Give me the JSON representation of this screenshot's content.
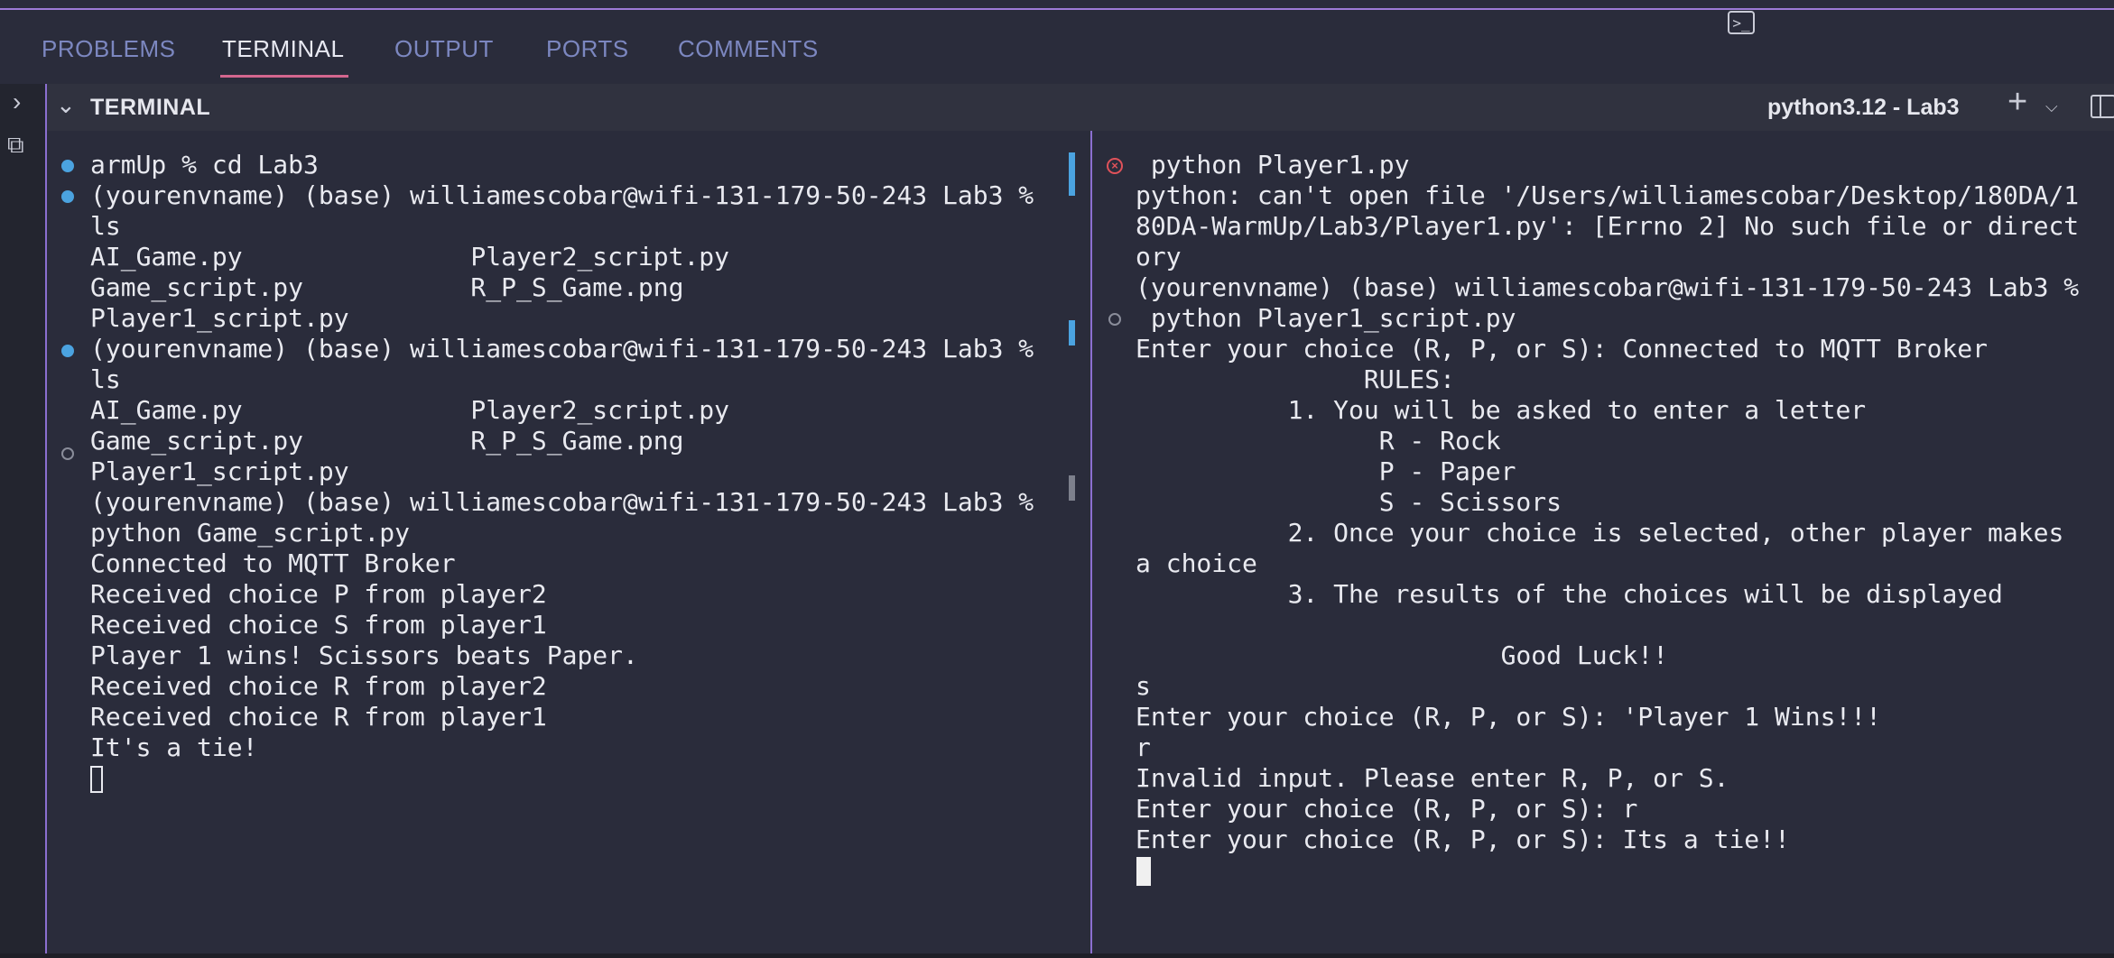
{
  "tabs": [
    {
      "label": "PROBLEMS",
      "active": false
    },
    {
      "label": "TERMINAL",
      "active": true
    },
    {
      "label": "OUTPUT",
      "active": false
    },
    {
      "label": "PORTS",
      "active": false
    },
    {
      "label": "COMMENTS",
      "active": false
    }
  ],
  "panel": {
    "title": "TERMINAL",
    "profile_label": "python3.12 - Lab3",
    "icons": [
      "chevron-down-icon",
      "terminal-icon",
      "plus-icon",
      "chevron-down-icon",
      "split-icon"
    ]
  },
  "left_terminal": {
    "lines": [
      "armUp % cd Lab3",
      "(yourenvname) (base) williamescobar@wifi-131-179-50-243 Lab3 %",
      "ls",
      "AI_Game.py               Player2_script.py",
      "Game_script.py           R_P_S_Game.png",
      "Player1_script.py",
      "(yourenvname) (base) williamescobar@wifi-131-179-50-243 Lab3 %",
      "ls",
      "AI_Game.py               Player2_script.py",
      "Game_script.py           R_P_S_Game.png",
      "Player1_script.py",
      "(yourenvname) (base) williamescobar@wifi-131-179-50-243 Lab3 %",
      "python Game_script.py",
      "Connected to MQTT Broker",
      "Received choice P from player2",
      "Received choice S from player1",
      "Player 1 wins! Scissors beats Paper.",
      "Received choice R from player2",
      "Received choice R from player1",
      "It's a tie!"
    ]
  },
  "right_terminal": {
    "lines": [
      " python Player1.py",
      "python: can't open file '/Users/williamescobar/Desktop/180DA/1",
      "80DA-WarmUp/Lab3/Player1.py': [Errno 2] No such file or direct",
      "ory",
      "(yourenvname) (base) williamescobar@wifi-131-179-50-243 Lab3 %",
      " python Player1_script.py",
      "Enter your choice (R, P, or S): Connected to MQTT Broker",
      "               RULES:",
      "          1. You will be asked to enter a letter",
      "                R - Rock",
      "                P - Paper",
      "                S - Scissors",
      "          2. Once your choice is selected, other player makes",
      "a choice",
      "          3. The results of the choices will be displayed",
      "",
      "                        Good Luck!!",
      "s",
      "Enter your choice (R, P, or S): 'Player 1 Wins!!!",
      "r",
      "Invalid input. Please enter R, P, or S.",
      "Enter your choice (R, P, or S): r",
      "Enter your choice (R, P, or S): Its a tie!!"
    ]
  },
  "colors": {
    "background": "#2a2c3b",
    "accent": "#8b6fd0",
    "tab_underline": "#d3668e",
    "success_dot": "#4ba3e0",
    "error": "#e0525a"
  }
}
